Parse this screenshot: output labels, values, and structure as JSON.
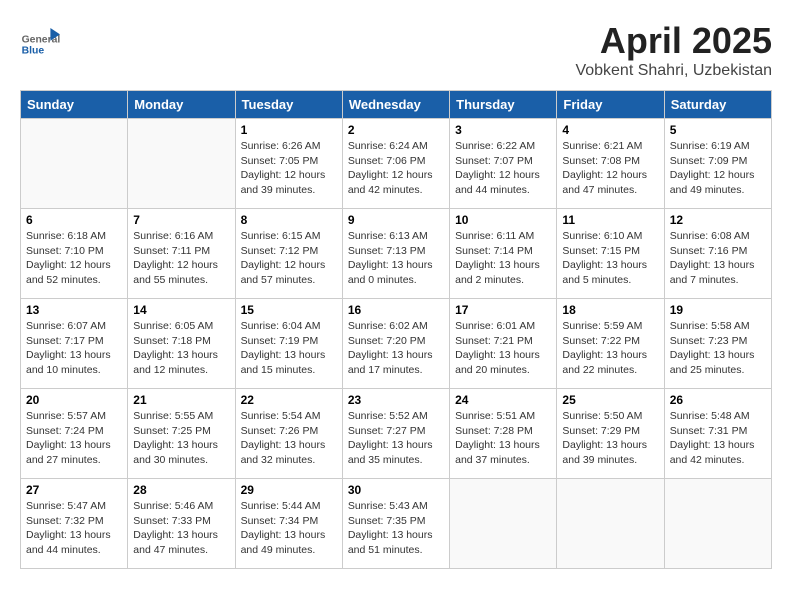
{
  "header": {
    "logo_general": "General",
    "logo_blue": "Blue",
    "month": "April 2025",
    "location": "Vobkent Shahri, Uzbekistan"
  },
  "weekdays": [
    "Sunday",
    "Monday",
    "Tuesday",
    "Wednesday",
    "Thursday",
    "Friday",
    "Saturday"
  ],
  "weeks": [
    [
      {
        "day": "",
        "sunrise": "",
        "sunset": "",
        "daylight": ""
      },
      {
        "day": "",
        "sunrise": "",
        "sunset": "",
        "daylight": ""
      },
      {
        "day": "1",
        "sunrise": "Sunrise: 6:26 AM",
        "sunset": "Sunset: 7:05 PM",
        "daylight": "Daylight: 12 hours and 39 minutes."
      },
      {
        "day": "2",
        "sunrise": "Sunrise: 6:24 AM",
        "sunset": "Sunset: 7:06 PM",
        "daylight": "Daylight: 12 hours and 42 minutes."
      },
      {
        "day": "3",
        "sunrise": "Sunrise: 6:22 AM",
        "sunset": "Sunset: 7:07 PM",
        "daylight": "Daylight: 12 hours and 44 minutes."
      },
      {
        "day": "4",
        "sunrise": "Sunrise: 6:21 AM",
        "sunset": "Sunset: 7:08 PM",
        "daylight": "Daylight: 12 hours and 47 minutes."
      },
      {
        "day": "5",
        "sunrise": "Sunrise: 6:19 AM",
        "sunset": "Sunset: 7:09 PM",
        "daylight": "Daylight: 12 hours and 49 minutes."
      }
    ],
    [
      {
        "day": "6",
        "sunrise": "Sunrise: 6:18 AM",
        "sunset": "Sunset: 7:10 PM",
        "daylight": "Daylight: 12 hours and 52 minutes."
      },
      {
        "day": "7",
        "sunrise": "Sunrise: 6:16 AM",
        "sunset": "Sunset: 7:11 PM",
        "daylight": "Daylight: 12 hours and 55 minutes."
      },
      {
        "day": "8",
        "sunrise": "Sunrise: 6:15 AM",
        "sunset": "Sunset: 7:12 PM",
        "daylight": "Daylight: 12 hours and 57 minutes."
      },
      {
        "day": "9",
        "sunrise": "Sunrise: 6:13 AM",
        "sunset": "Sunset: 7:13 PM",
        "daylight": "Daylight: 13 hours and 0 minutes."
      },
      {
        "day": "10",
        "sunrise": "Sunrise: 6:11 AM",
        "sunset": "Sunset: 7:14 PM",
        "daylight": "Daylight: 13 hours and 2 minutes."
      },
      {
        "day": "11",
        "sunrise": "Sunrise: 6:10 AM",
        "sunset": "Sunset: 7:15 PM",
        "daylight": "Daylight: 13 hours and 5 minutes."
      },
      {
        "day": "12",
        "sunrise": "Sunrise: 6:08 AM",
        "sunset": "Sunset: 7:16 PM",
        "daylight": "Daylight: 13 hours and 7 minutes."
      }
    ],
    [
      {
        "day": "13",
        "sunrise": "Sunrise: 6:07 AM",
        "sunset": "Sunset: 7:17 PM",
        "daylight": "Daylight: 13 hours and 10 minutes."
      },
      {
        "day": "14",
        "sunrise": "Sunrise: 6:05 AM",
        "sunset": "Sunset: 7:18 PM",
        "daylight": "Daylight: 13 hours and 12 minutes."
      },
      {
        "day": "15",
        "sunrise": "Sunrise: 6:04 AM",
        "sunset": "Sunset: 7:19 PM",
        "daylight": "Daylight: 13 hours and 15 minutes."
      },
      {
        "day": "16",
        "sunrise": "Sunrise: 6:02 AM",
        "sunset": "Sunset: 7:20 PM",
        "daylight": "Daylight: 13 hours and 17 minutes."
      },
      {
        "day": "17",
        "sunrise": "Sunrise: 6:01 AM",
        "sunset": "Sunset: 7:21 PM",
        "daylight": "Daylight: 13 hours and 20 minutes."
      },
      {
        "day": "18",
        "sunrise": "Sunrise: 5:59 AM",
        "sunset": "Sunset: 7:22 PM",
        "daylight": "Daylight: 13 hours and 22 minutes."
      },
      {
        "day": "19",
        "sunrise": "Sunrise: 5:58 AM",
        "sunset": "Sunset: 7:23 PM",
        "daylight": "Daylight: 13 hours and 25 minutes."
      }
    ],
    [
      {
        "day": "20",
        "sunrise": "Sunrise: 5:57 AM",
        "sunset": "Sunset: 7:24 PM",
        "daylight": "Daylight: 13 hours and 27 minutes."
      },
      {
        "day": "21",
        "sunrise": "Sunrise: 5:55 AM",
        "sunset": "Sunset: 7:25 PM",
        "daylight": "Daylight: 13 hours and 30 minutes."
      },
      {
        "day": "22",
        "sunrise": "Sunrise: 5:54 AM",
        "sunset": "Sunset: 7:26 PM",
        "daylight": "Daylight: 13 hours and 32 minutes."
      },
      {
        "day": "23",
        "sunrise": "Sunrise: 5:52 AM",
        "sunset": "Sunset: 7:27 PM",
        "daylight": "Daylight: 13 hours and 35 minutes."
      },
      {
        "day": "24",
        "sunrise": "Sunrise: 5:51 AM",
        "sunset": "Sunset: 7:28 PM",
        "daylight": "Daylight: 13 hours and 37 minutes."
      },
      {
        "day": "25",
        "sunrise": "Sunrise: 5:50 AM",
        "sunset": "Sunset: 7:29 PM",
        "daylight": "Daylight: 13 hours and 39 minutes."
      },
      {
        "day": "26",
        "sunrise": "Sunrise: 5:48 AM",
        "sunset": "Sunset: 7:31 PM",
        "daylight": "Daylight: 13 hours and 42 minutes."
      }
    ],
    [
      {
        "day": "27",
        "sunrise": "Sunrise: 5:47 AM",
        "sunset": "Sunset: 7:32 PM",
        "daylight": "Daylight: 13 hours and 44 minutes."
      },
      {
        "day": "28",
        "sunrise": "Sunrise: 5:46 AM",
        "sunset": "Sunset: 7:33 PM",
        "daylight": "Daylight: 13 hours and 47 minutes."
      },
      {
        "day": "29",
        "sunrise": "Sunrise: 5:44 AM",
        "sunset": "Sunset: 7:34 PM",
        "daylight": "Daylight: 13 hours and 49 minutes."
      },
      {
        "day": "30",
        "sunrise": "Sunrise: 5:43 AM",
        "sunset": "Sunset: 7:35 PM",
        "daylight": "Daylight: 13 hours and 51 minutes."
      },
      {
        "day": "",
        "sunrise": "",
        "sunset": "",
        "daylight": ""
      },
      {
        "day": "",
        "sunrise": "",
        "sunset": "",
        "daylight": ""
      },
      {
        "day": "",
        "sunrise": "",
        "sunset": "",
        "daylight": ""
      }
    ]
  ]
}
